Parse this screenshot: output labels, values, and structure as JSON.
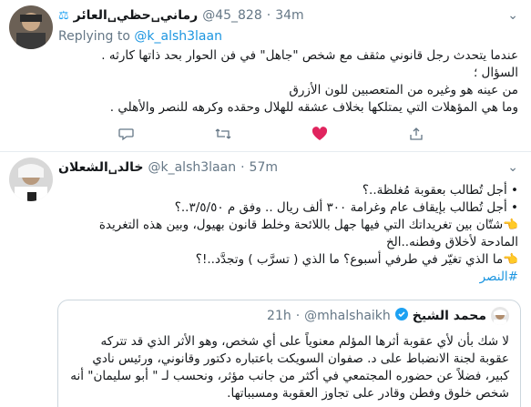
{
  "tweet1": {
    "name": "رماني␣حظي␣العائر",
    "handle": "@45_828",
    "time": "34m",
    "reply_prefix": "Replying to",
    "reply_to": "@k_alsh3laan",
    "body": [
      "عندما يتحدث رجل قانوني مثقف مع شخص \"جاهل\" في فن الحوار بحد ذاتها كارثه .",
      "السؤال ؛",
      "من عينه هو وغيره من المتعصبين للون الأزرق",
      "وما هي المؤهلات التي يمتلكها بخلاف عشقه للهلال وحقده وكرهه للنصر والأهلي ."
    ],
    "like_color": "#e0245e",
    "icons": [
      "reply-icon",
      "retweet-icon",
      "like-icon",
      "share-icon"
    ]
  },
  "tweet2": {
    "name": "خالد␣الشعلان",
    "handle": "@k_alsh3laan",
    "time": "57m",
    "lines": [
      "• أجل تُطالب بعقوبة مُغلظة..؟",
      "• أجل تُطالب بإيقاف عام وغرامة ٣٠٠ ألف ريال .. وفق م ٣/٥/٥٠..؟",
      "👈شتّان بين تغريداتك التي فيها جهل باللائحة وخلط قانون بهيول، وبين هذه التغريدة المادحة لأخلاق وفطنه..الخ",
      "👈ما الذي تغيّر في طرفي أسبوع؟ ما الذي ( تسرَّب ) وتجدَّد..!؟"
    ],
    "hashtag": "#النصر"
  },
  "quote": {
    "name": "محمد الشيخ",
    "handle": "@mhalshaikh",
    "time": "21h",
    "body": "لا شك بأن لأي عقوبة أثرها المؤلم معنوياً على أي شخص، وهو الأثر الذي قد تتركه عقوبة لجنة الانضباط على د. صفوان السويكت باعتباره دكتور وقانوني، ورئيس نادي كبير، فضلاً عن حضوره المجتمعي في أكثر من جانب مؤثر، ونحسب لـ \" أبو سليمان\" أنه شخص خلوق وفطن وقادر على تجاوز العقوبة ومسبباتها."
  }
}
